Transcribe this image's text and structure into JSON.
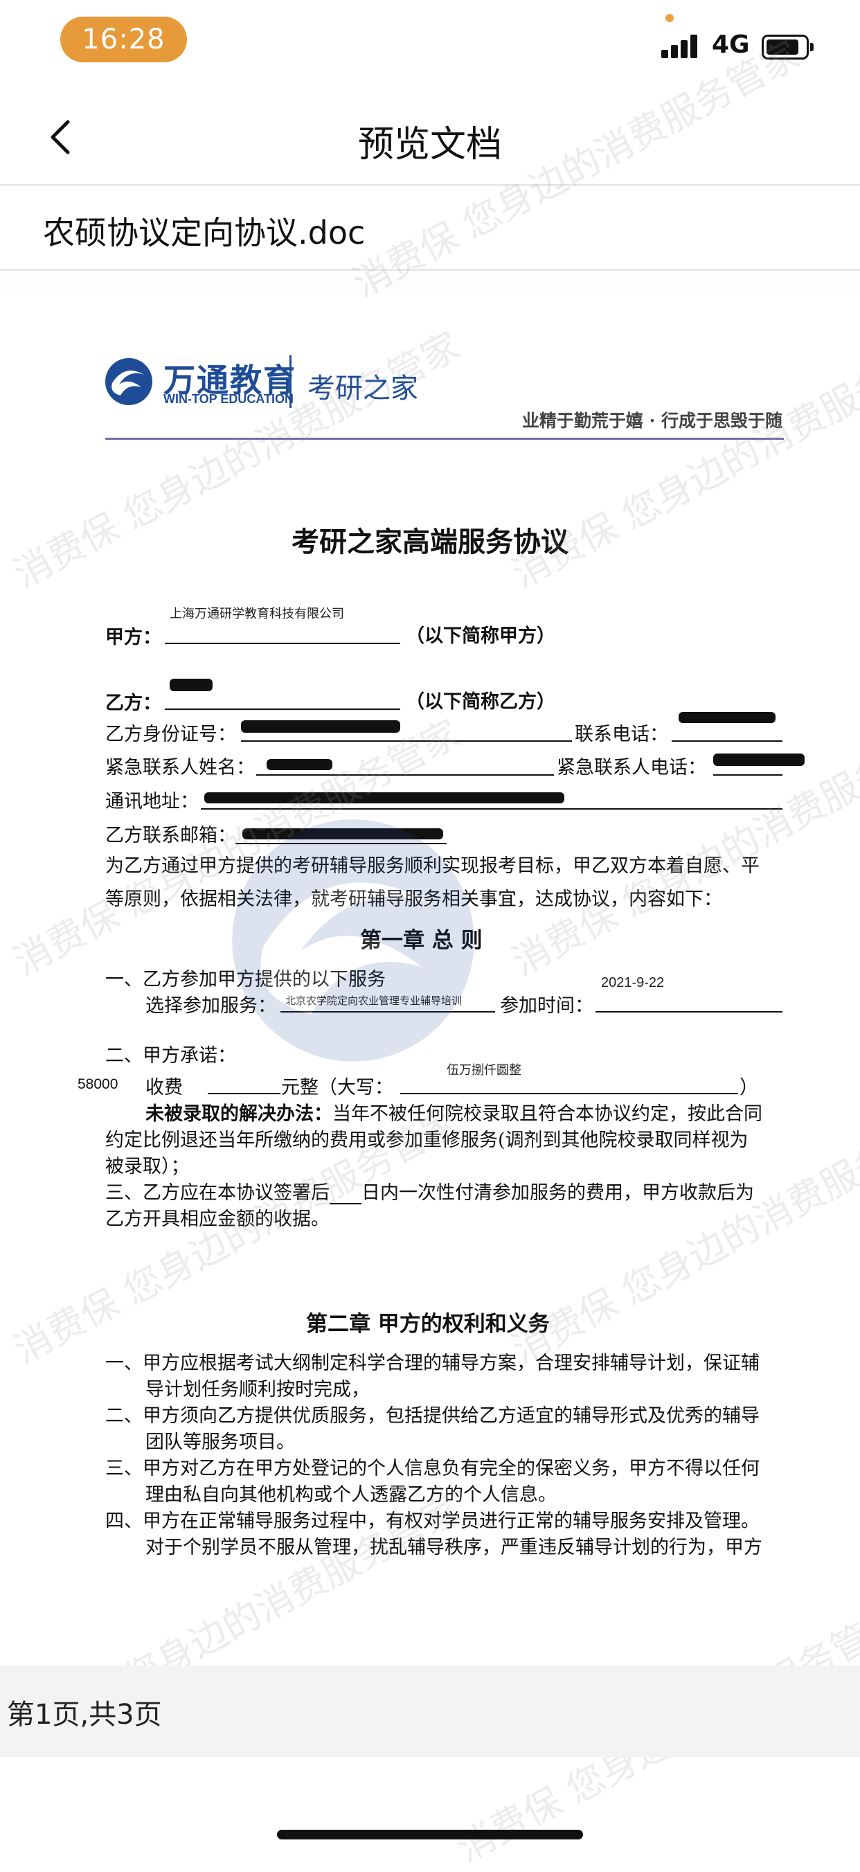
{
  "status_bar": {
    "time": "16:28",
    "network": "4G"
  },
  "nav": {
    "title": "预览文档"
  },
  "file": {
    "name": "农硕协议定向协议.doc"
  },
  "watermark": {
    "text": "消费保 您身边的消费服务管家"
  },
  "document": {
    "logo": {
      "cn": "万通教育",
      "en": "WIN-TOP EDUCATION",
      "sub": "考研之家"
    },
    "slogan": "业精于勤荒于嬉 · 行成于思毁于随",
    "title": "考研之家高端服务协议",
    "party_a": {
      "label": "甲方：",
      "value": "上海万通研学教育科技有限公司",
      "suffix": "（以下简称甲方）"
    },
    "party_b": {
      "label": "乙方：",
      "suffix": "（以下简称乙方）"
    },
    "id_label": "乙方身份证号：",
    "phone_label": "联系电话：",
    "emergency_name_label": "紧急联系人姓名：",
    "emergency_phone_label": "紧急联系人电话：",
    "address_label": "通讯地址：",
    "email_label": "乙方联系邮箱：",
    "intro_1": "为乙方通过甲方提供的考研辅导服务顺利实现报考目标，甲乙双方本着自愿、平",
    "intro_2": "等原则，依据相关法律，就考研辅导服务相关事宜，达成协议，内容如下：",
    "chapter1": "第一章  总    则",
    "c1_item1": "一、乙方参加甲方提供的以下服务",
    "c1_service_label": "选择参加服务：",
    "c1_service_value": "北京农学院定向农业管理专业辅导培训",
    "c1_time_label": "参加时间：",
    "c1_time_value": "2021-9-22",
    "c1_item2": "二、甲方承诺：",
    "c1_fee_amount": "58000",
    "c1_fee_label": "收费",
    "c1_fee_unit": "元整（大写：",
    "c1_fee_upper": "伍万捌仟圆整",
    "c1_fee_close": "）",
    "c1_solution_bold": "未被录取的解决办法：",
    "c1_solution_1": "当年不被任何院校录取且符合本协议约定，按此合同",
    "c1_solution_2": "约定比例退还当年所缴纳的费用或参加重修服务(调剂到其他院校录取同样视为",
    "c1_solution_3": "被录取）；",
    "c1_item3_a": "三、乙方应在本协议签署后",
    "c1_item3_b": "日内一次性付清参加服务的费用，甲方收款后为",
    "c1_item3_c": "乙方开具相应金额的收据。",
    "chapter2": "第二章    甲方的权利和义务",
    "c2": [
      "一、甲方应根据考试大纲制定科学合理的辅导方案，合理安排辅导计划，保证辅",
      "导计划任务顺利按时完成，",
      "二、甲方须向乙方提供优质服务，包括提供给乙方适宜的辅导形式及优秀的辅导",
      "团队等服务项目。",
      "三、甲方对乙方在甲方处登记的个人信息负有完全的保密义务，甲方不得以任何",
      "理由私自向其他机构或个人透露乙方的个人信息。",
      "四、甲方在正常辅导服务过程中，有权对学员进行正常的辅导服务安排及管理。",
      "对于个别学员不服从管理，扰乱辅导秩序，严重违反辅导计划的行为，甲方"
    ]
  },
  "page_indicator": "第1页,共3页"
}
